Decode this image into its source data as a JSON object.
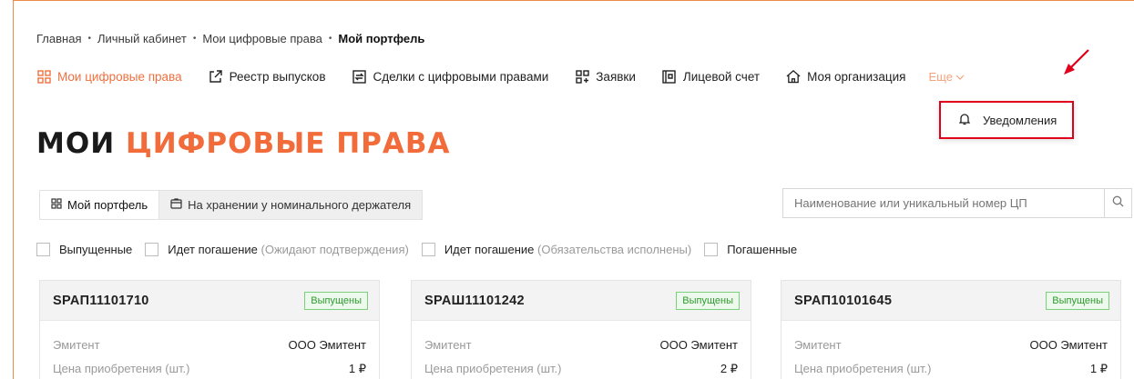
{
  "breadcrumb": {
    "items": [
      "Главная",
      "Личный кабинет",
      "Мои цифровые права"
    ],
    "current": "Мой портфель",
    "separator": "•"
  },
  "nav": {
    "items": [
      {
        "label": "Мои цифровые права",
        "icon": "grid-icon",
        "active": true
      },
      {
        "label": "Реестр выпусков",
        "icon": "external-link-icon"
      },
      {
        "label": "Сделки с цифровыми правами",
        "icon": "exchange-icon"
      },
      {
        "label": "Заявки",
        "icon": "apps-icon"
      },
      {
        "label": "Лицевой счет",
        "icon": "account-icon"
      },
      {
        "label": "Моя организация",
        "icon": "home-icon"
      }
    ],
    "more": "Еще"
  },
  "dropdown": {
    "label": "Уведомления",
    "icon": "bell-icon"
  },
  "page_title": {
    "part1": "МОИ",
    "part2": "ЦИФРОВЫЕ ПРАВА"
  },
  "tabs": [
    {
      "label": "Мой портфель",
      "icon": "grid-icon"
    },
    {
      "label": "На хранении у номинального держателя",
      "icon": "wallet-icon"
    }
  ],
  "search": {
    "placeholder": "Наименование или уникальный номер ЦП"
  },
  "filters": [
    {
      "label": "Выпущенные",
      "note": ""
    },
    {
      "label": "Идет погашение",
      "note": "(Ожидают подтверждения)"
    },
    {
      "label": "Идет погашение",
      "note": "(Обязательства исполнены)"
    },
    {
      "label": "Погашенные",
      "note": ""
    }
  ],
  "cards": [
    {
      "code": "SPAП11101710",
      "status": "Выпущены",
      "issuer_label": "Эмитент",
      "issuer": "ООО Эмитент",
      "price_label": "Цена приобретения (шт.)",
      "price": "1 ₽"
    },
    {
      "code": "SPAШ11101242",
      "status": "Выпущены",
      "issuer_label": "Эмитент",
      "issuer": "ООО Эмитент",
      "price_label": "Цена приобретения (шт.)",
      "price": "2 ₽"
    },
    {
      "code": "SPAП10101645",
      "status": "Выпущены",
      "issuer_label": "Эмитент",
      "issuer": "ООО Эмитент",
      "price_label": "Цена приобретения (шт.)",
      "price": "1 ₽"
    }
  ],
  "colors": {
    "accent": "#f26b3a",
    "highlight": "#e0001b",
    "badge": "#2f9a2f"
  }
}
